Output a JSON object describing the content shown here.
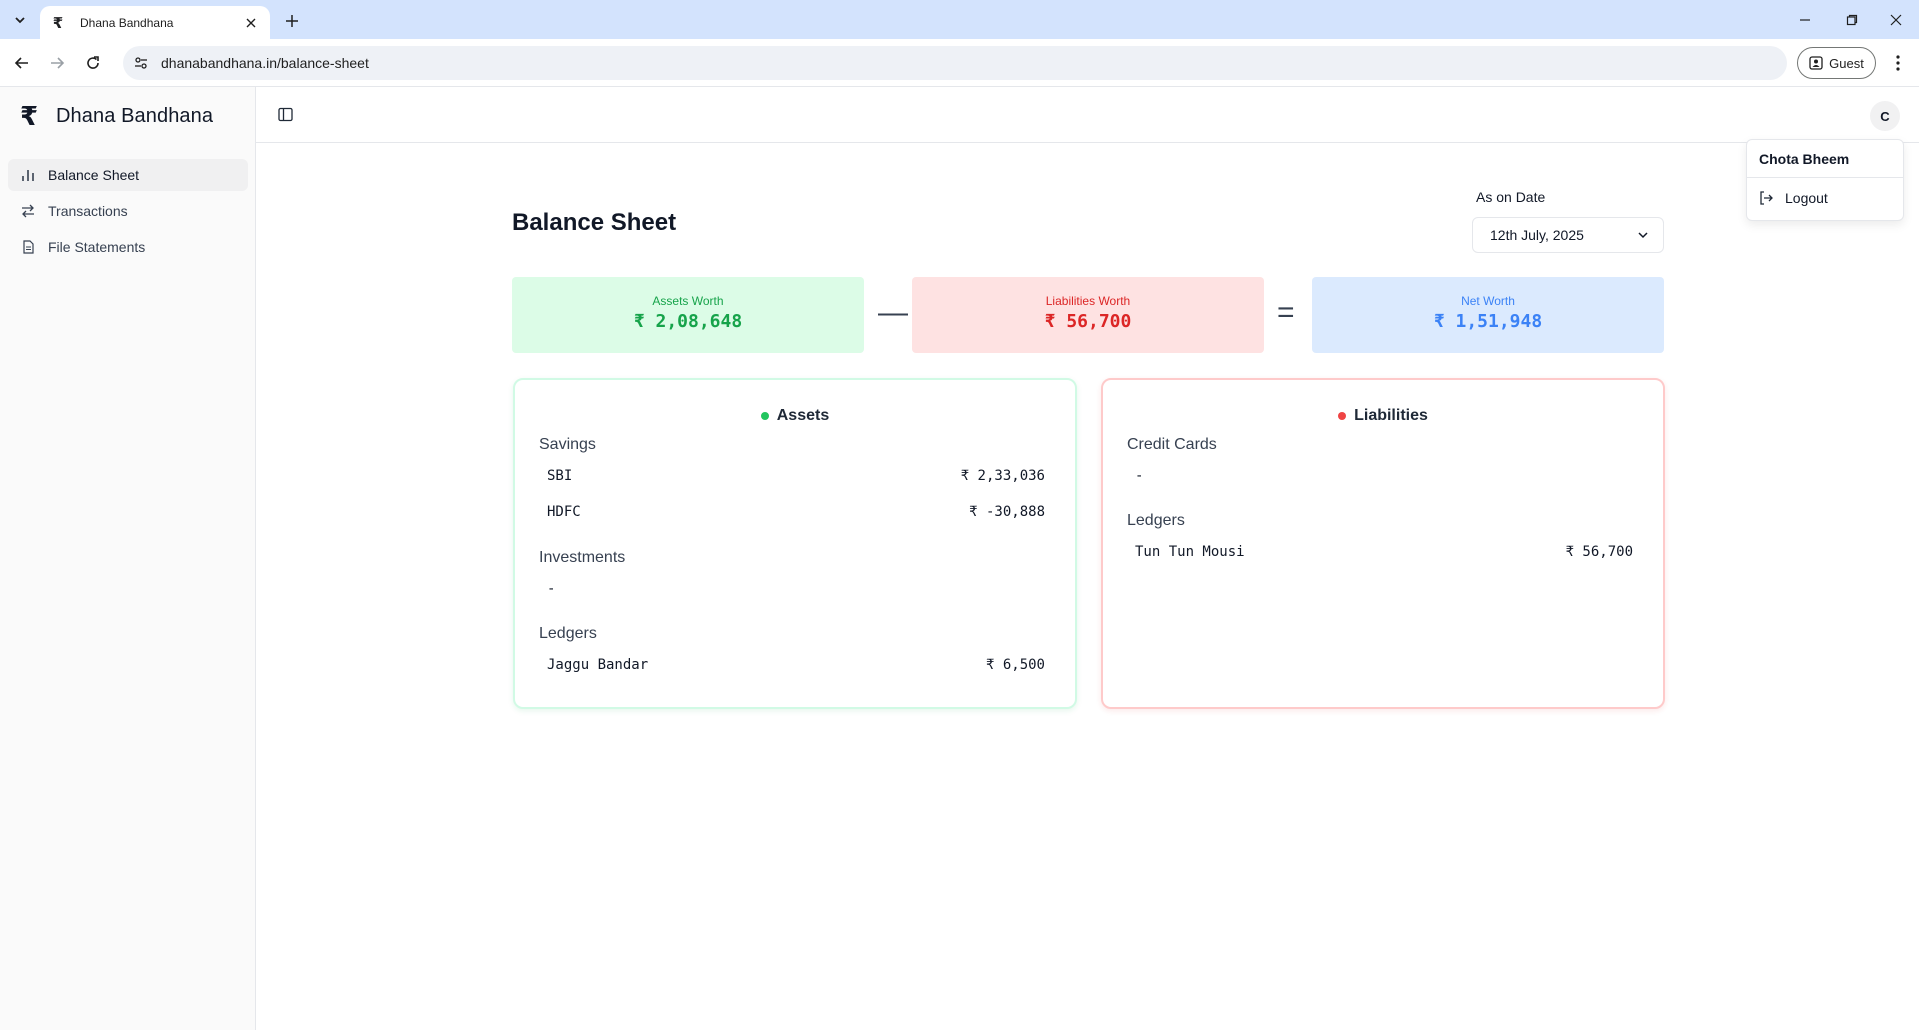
{
  "browser": {
    "tab_title": "Dhana Bandhana",
    "url": "dhanabandhana.in/balance-sheet",
    "profile_label": "Guest"
  },
  "app": {
    "brand_logo": "₹",
    "brand_name": "Dhana Bandhana",
    "nav": [
      {
        "label": "Balance Sheet",
        "icon": "bar-chart-icon",
        "active": true
      },
      {
        "label": "Transactions",
        "icon": "arrows-left-right-icon",
        "active": false
      },
      {
        "label": "File Statements",
        "icon": "file-text-icon",
        "active": false
      }
    ],
    "avatar_initial": "C",
    "user_menu": {
      "user_name": "Chota Bheem",
      "logout_label": "Logout"
    }
  },
  "page": {
    "title": "Balance Sheet",
    "date_label": "As on Date",
    "date_value": "12th July, 2025"
  },
  "summary": {
    "assets_label": "Assets Worth",
    "assets_value": "₹ 2,08,648",
    "minus_sign": "—",
    "liabilities_label": "Liabilities Worth",
    "liabilities_value": "₹ 56,700",
    "equals_sign": "=",
    "net_label": "Net Worth",
    "net_value": "₹ 1,51,948"
  },
  "assets": {
    "title": "Assets",
    "savings_title": "Savings",
    "savings": [
      {
        "name": "SBI",
        "amount": "₹ 2,33,036"
      },
      {
        "name": "HDFC",
        "amount": "₹ -30,888"
      }
    ],
    "investments_title": "Investments",
    "investments_empty": "-",
    "ledgers_title": "Ledgers",
    "ledgers": [
      {
        "name": "Jaggu Bandar",
        "amount": "₹ 6,500"
      }
    ]
  },
  "liabilities": {
    "title": "Liabilities",
    "credit_cards_title": "Credit Cards",
    "credit_cards_empty": "-",
    "ledgers_title": "Ledgers",
    "ledgers": [
      {
        "name": "Tun Tun Mousi",
        "amount": "₹ 56,700"
      }
    ]
  },
  "colors": {
    "assets": "#16a34a",
    "liabilities": "#dc2626",
    "net": "#3b82f6",
    "assets_bg": "#dcfce7",
    "liabilities_bg": "#fee2e2",
    "net_bg": "#dbeafe"
  }
}
